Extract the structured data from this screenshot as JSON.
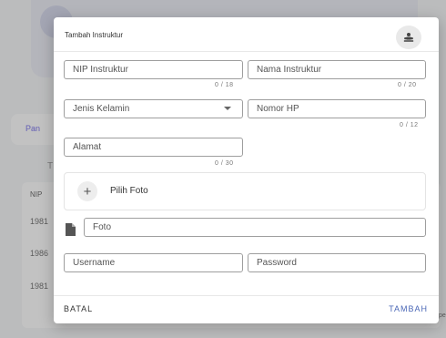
{
  "background": {
    "tab_partial": "Pan",
    "t_partial": "T",
    "table_header": "NIP",
    "rows": [
      "1981",
      "1986",
      "1981"
    ],
    "cut_text": "pe"
  },
  "modal": {
    "title": "Tambah Instruktur",
    "person_icon": "person-group-icon",
    "fields": {
      "nip": {
        "label": "NIP Instruktur",
        "counter": "0 / 18"
      },
      "nama": {
        "label": "Nama Instruktur",
        "counter": "0 / 20"
      },
      "jenis_kelamin": {
        "label": "Jenis Kelamin"
      },
      "nomor_hp": {
        "label": "Nomor HP",
        "counter": "0 / 12"
      },
      "alamat": {
        "label": "Alamat",
        "counter": "0 / 30"
      },
      "foto": {
        "label": "Foto"
      },
      "username": {
        "label": "Username"
      },
      "password": {
        "label": "Password"
      }
    },
    "pilih_foto": "Pilih Foto",
    "buttons": {
      "batal": "BATAL",
      "tambah": "TAMBAH"
    },
    "colors": {
      "accent": "#4a67b6",
      "border": "#9e9e9e"
    }
  }
}
